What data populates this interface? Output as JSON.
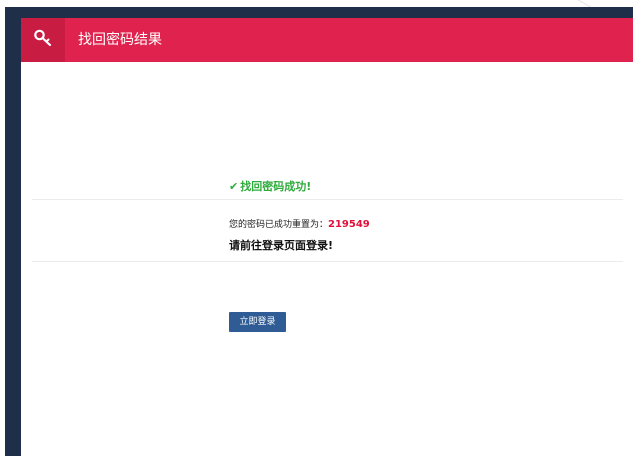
{
  "header": {
    "title": "找回密码结果",
    "icon": "key-icon",
    "bg_color": "#e0234e"
  },
  "result": {
    "check_icon": "✔",
    "success_text": "找回密码成功!",
    "reset_prefix": "您的密码已成功重置为：",
    "new_password": "219549",
    "instruction": "请前往登录页面登录!"
  },
  "actions": {
    "login_label": "立即登录",
    "button_color": "#2f5c94"
  }
}
